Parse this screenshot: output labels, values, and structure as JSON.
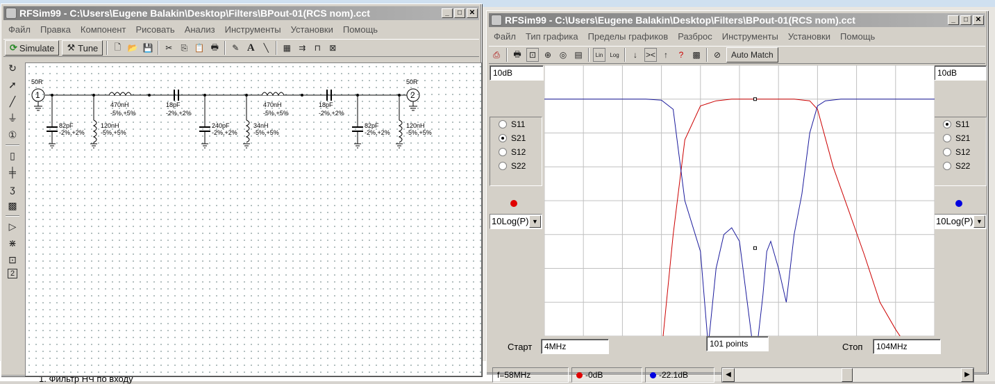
{
  "win_schematic": {
    "title": "RFSim99 - C:\\Users\\Eugene Balakin\\Desktop\\Filters\\BPout-01(RCS nom).cct",
    "menu": [
      "Файл",
      "Правка",
      "Компонент",
      "Рисовать",
      "Анализ",
      "Инструменты",
      "Установки",
      "Помощь"
    ],
    "simulate_label": "Simulate",
    "tune_label": "Tune",
    "port1_impedance": "50R",
    "port2_impedance": "50R",
    "port1_num": "1",
    "port2_num": "2",
    "components": [
      {
        "value": "470nH",
        "tol": "-5%,+5%"
      },
      {
        "value": "18pF",
        "tol": "-2%,+2%"
      },
      {
        "value": "470nH",
        "tol": "-5%,+5%"
      },
      {
        "value": "18pF",
        "tol": "-2%,+2%"
      },
      {
        "value": "82pF",
        "tol": "-2%,+2%"
      },
      {
        "value": "120nH",
        "tol": "-5%,+5%"
      },
      {
        "value": "240pF",
        "tol": "-2%,+2%"
      },
      {
        "value": "34nH",
        "tol": "-5%,+5%"
      },
      {
        "value": "82pF",
        "tol": "-2%,+2%"
      },
      {
        "value": "120nH",
        "tol": "-5%,+5%"
      }
    ],
    "tool_icons": [
      "rotate-icon",
      "pointer-icon",
      "wire-icon",
      "ground-icon",
      "port-icon",
      "resistor-icon",
      "capacitor-icon",
      "inductor-icon",
      "transformer-icon",
      "amplifier-icon",
      "transmission-line-icon",
      "box-icon",
      "two-port-icon"
    ]
  },
  "win_graph": {
    "title": "RFSim99 - C:\\Users\\Eugene Balakin\\Desktop\\Filters\\BPout-01(RCS nom).cct",
    "menu": [
      "Файл",
      "Тип графика",
      "Пределы графиков",
      "Разброс",
      "Инструменты",
      "Установки",
      "Помощь"
    ],
    "auto_match_label": "Auto Match",
    "left_scale": "10dB",
    "right_scale": "10dB",
    "left_radios": [
      "S11",
      "S21",
      "S12",
      "S22"
    ],
    "left_selected": "S21",
    "right_radios": [
      "S11",
      "S21",
      "S12",
      "S22"
    ],
    "right_selected": "S11",
    "left_mode": "10Log(P)",
    "right_mode": "10Log(P)",
    "start_label": "Старт",
    "start_value": "4MHz",
    "points_value": "101 points",
    "stop_label": "Стоп",
    "stop_value": "104MHz",
    "status_freq": "f=58MHz",
    "status_red": "-0dB",
    "status_blue": "-22.1dB",
    "colors": {
      "s21_trace": "#cc0000",
      "s11_trace": "#1a1a9c",
      "grid": "#c0c0c0"
    }
  },
  "background": {
    "doc_text": "1.    Фильтр НЧ по входу"
  },
  "chart_data": {
    "type": "line",
    "xlabel": "",
    "ylabel": "",
    "xlim": [
      4,
      104
    ],
    "ylim": [
      -70,
      10
    ],
    "y_div": 10,
    "x_div": 10,
    "grid": true,
    "series": [
      {
        "name": "S21",
        "x": [
          4,
          14,
          24,
          30,
          34,
          37,
          40,
          44,
          48,
          52,
          58,
          64,
          68,
          72,
          74,
          78,
          82,
          86,
          90,
          94,
          98,
          104
        ],
        "y": [
          -120,
          -120,
          -120,
          -100,
          -75,
          -40,
          -12,
          -2,
          -0.5,
          0,
          0,
          0,
          0,
          -0.5,
          -3,
          -20,
          -33,
          -46,
          -60,
          -68,
          -75,
          -90
        ]
      },
      {
        "name": "S11",
        "x": [
          4,
          14,
          24,
          30,
          34,
          37,
          40,
          44,
          46,
          48,
          50,
          52,
          54,
          56,
          58,
          60,
          61,
          62,
          64,
          66,
          68,
          70,
          72,
          74,
          76,
          80,
          90,
          104
        ],
        "y": [
          0,
          0,
          0,
          0,
          -0.3,
          -3,
          -30,
          -45,
          -73,
          -50,
          -40,
          -38,
          -42,
          -60,
          -82,
          -58,
          -45,
          -42,
          -50,
          -60,
          -40,
          -28,
          -10,
          -2,
          -0.5,
          0,
          0,
          0
        ]
      }
    ]
  }
}
